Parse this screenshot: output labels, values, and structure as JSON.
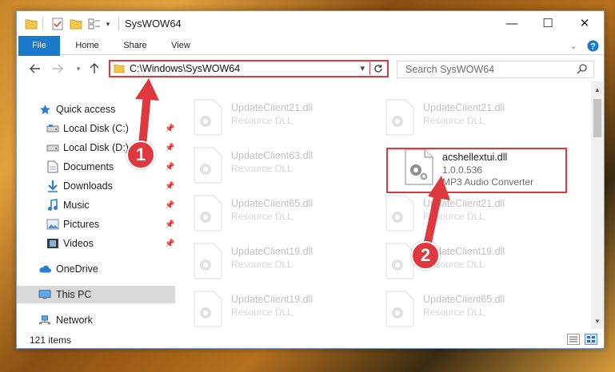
{
  "window": {
    "title": "SysWOW64",
    "controls": {
      "minimize": "—",
      "maximize": "☐",
      "close": "✕"
    }
  },
  "ribbon": {
    "tabs": [
      {
        "label": "File"
      },
      {
        "label": "Home"
      },
      {
        "label": "Share"
      },
      {
        "label": "View"
      }
    ]
  },
  "address": {
    "path": "C:\\Windows\\SysWOW64",
    "search_placeholder": "Search SysWOW64"
  },
  "nav": {
    "items": [
      {
        "label": "Quick access",
        "icon": "star-icon"
      },
      {
        "label": "Local Disk (C:)",
        "icon": "drive-icon"
      },
      {
        "label": "Local Disk (D:)",
        "icon": "drive-icon"
      },
      {
        "label": "Documents",
        "icon": "documents-icon"
      },
      {
        "label": "Downloads",
        "icon": "download-icon"
      },
      {
        "label": "Music",
        "icon": "music-icon"
      },
      {
        "label": "Pictures",
        "icon": "pictures-icon"
      },
      {
        "label": "Videos",
        "icon": "videos-icon"
      },
      {
        "label": "OneDrive",
        "icon": "cloud-icon"
      },
      {
        "label": "This PC",
        "icon": "computer-icon"
      },
      {
        "label": "Network",
        "icon": "network-icon"
      }
    ]
  },
  "files": [
    {
      "name": "UpdateClient21.dll",
      "desc": "Resource DLL"
    },
    {
      "name": "UpdateClient21.dll",
      "desc": "Resource DLL"
    },
    {
      "name": "UpdateClient63.dll",
      "desc": "Resource DLL"
    },
    {
      "name": "acshellextui.dll",
      "version": "1.0.0.536",
      "desc": "MP3 Audio Converter"
    },
    {
      "name": "UpdateClient65.dll",
      "desc": "Resource DLL"
    },
    {
      "name": "UpdateClient21.dll",
      "desc": "Resource DLL"
    },
    {
      "name": "UpdateClient19.dll",
      "desc": "Resource DLL"
    },
    {
      "name": "UpdateClient19.dll",
      "desc": "Resource DLL"
    },
    {
      "name": "UpdateClient19.dll",
      "desc": "Resource DLL"
    },
    {
      "name": "UpdateClient65.dll",
      "desc": "Resource DLL"
    }
  ],
  "status": {
    "item_count": "121 items"
  },
  "annotations": {
    "step1": "1",
    "step2": "2"
  },
  "colors": {
    "accent": "#1979ca",
    "highlight": "#e0383f"
  }
}
